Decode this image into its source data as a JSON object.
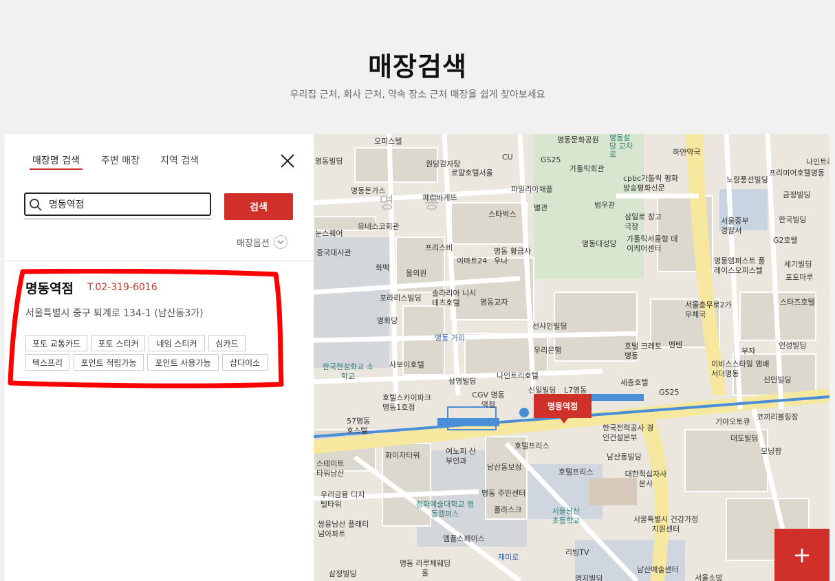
{
  "header": {
    "title": "매장검색",
    "subtitle": "우리집 근처, 회사 근처, 약속 장소 근처 매장을 쉽게 찾아보세요"
  },
  "panel": {
    "tabs": [
      {
        "label": "매장명 검색",
        "active": true
      },
      {
        "label": "주변 매장",
        "active": false
      },
      {
        "label": "지역 검색",
        "active": false
      }
    ],
    "search": {
      "value": "명동역점",
      "button": "검색"
    },
    "options_label": "매장옵션",
    "result": {
      "name": "명동역점",
      "tel": "T.02-319-6016",
      "address": "서울특별시 중구 퇴계로 134-1 (남산동3가)",
      "services": [
        "포토 교통카드",
        "포토 스티커",
        "네임 스티커",
        "심카드",
        "텍스프리",
        "포인트 적립가능",
        "포인트 사용가능",
        "샵다이소"
      ]
    }
  },
  "map": {
    "marker_label": "명동역점",
    "zoom_in_label": "+",
    "area_label": "명 동",
    "labels": [
      "오피스텔",
      "CU",
      "GS25",
      "명동빌딩",
      "원당감자탕",
      "명동문화공원",
      "명동성당 교차로",
      "하얀약국",
      "나인트리",
      "프리미어호텔명동",
      "로얄호텔서울",
      "가톨릭회관",
      "cpbc가톨릭 평화방송평화신문",
      "노량풍선빌딩",
      "명동돈가스",
      "파밀리아채플",
      "파리바게뜨",
      "범우관",
      "금정빌딩",
      "별관",
      "눈스퀘어",
      "유네스코회관",
      "스타벅스",
      "삼일로 창고극장",
      "서울중부 경찰서",
      "한국빌딩",
      "G2호텔",
      "중국대사관",
      "프리스비",
      "명동 황금사우나",
      "명동대성당",
      "가톨릭서울형 데이케어센터",
      "이마트24",
      "명동엠퍼스트 플레이스오피스텔",
      "세기빌딩",
      "화떡",
      "올의원",
      "포토마루",
      "포라리스빌딩",
      "솔라리아 니시테츠호텔",
      "명동교자",
      "서울충무로2가 우체국",
      "스타즈호텔",
      "명화당",
      "명동 거리",
      "선샤인빌딩",
      "부자",
      "인성빌딩",
      "사보이호텔",
      "우리은행",
      "호텔 크레토명동",
      "멘텐",
      "이비스스타일 앰배서더명동",
      "한국한성화교 소학교",
      "나인트리호텔",
      "삼영빌딩",
      "세종호텔",
      "신민빌딩",
      "신일빌딩",
      "L7명동",
      "호텔스카이파크 명동1호점",
      "CGV 명동역점",
      "GS25",
      "기아오토큐",
      "코끼리볼링장",
      "57명동 호스텔",
      "한국전력공사 경인건설본부",
      "대도빌딩",
      "호텔프리스",
      "화이자타워",
      "여노피 산부인과",
      "남산동빌딩",
      "모닝팜",
      "스테이트 타워남산",
      "남산동보성",
      "호텔프리스",
      "대한적십자사 본사",
      "우리금융 디지털타워",
      "명동 주민센터",
      "정화예술대학교 명동캠퍼스",
      "플라스크",
      "서울남산 초등학교",
      "쌍용남산 플래티넘아파트",
      "서울특별시 건강가정지원센터",
      "엠플스페이스",
      "리빙TV",
      "재미로",
      "명동 라루체웨딩홀",
      "삼정빌딩",
      "명지빌딩",
      "남산예술센터",
      "서울소방"
    ]
  }
}
